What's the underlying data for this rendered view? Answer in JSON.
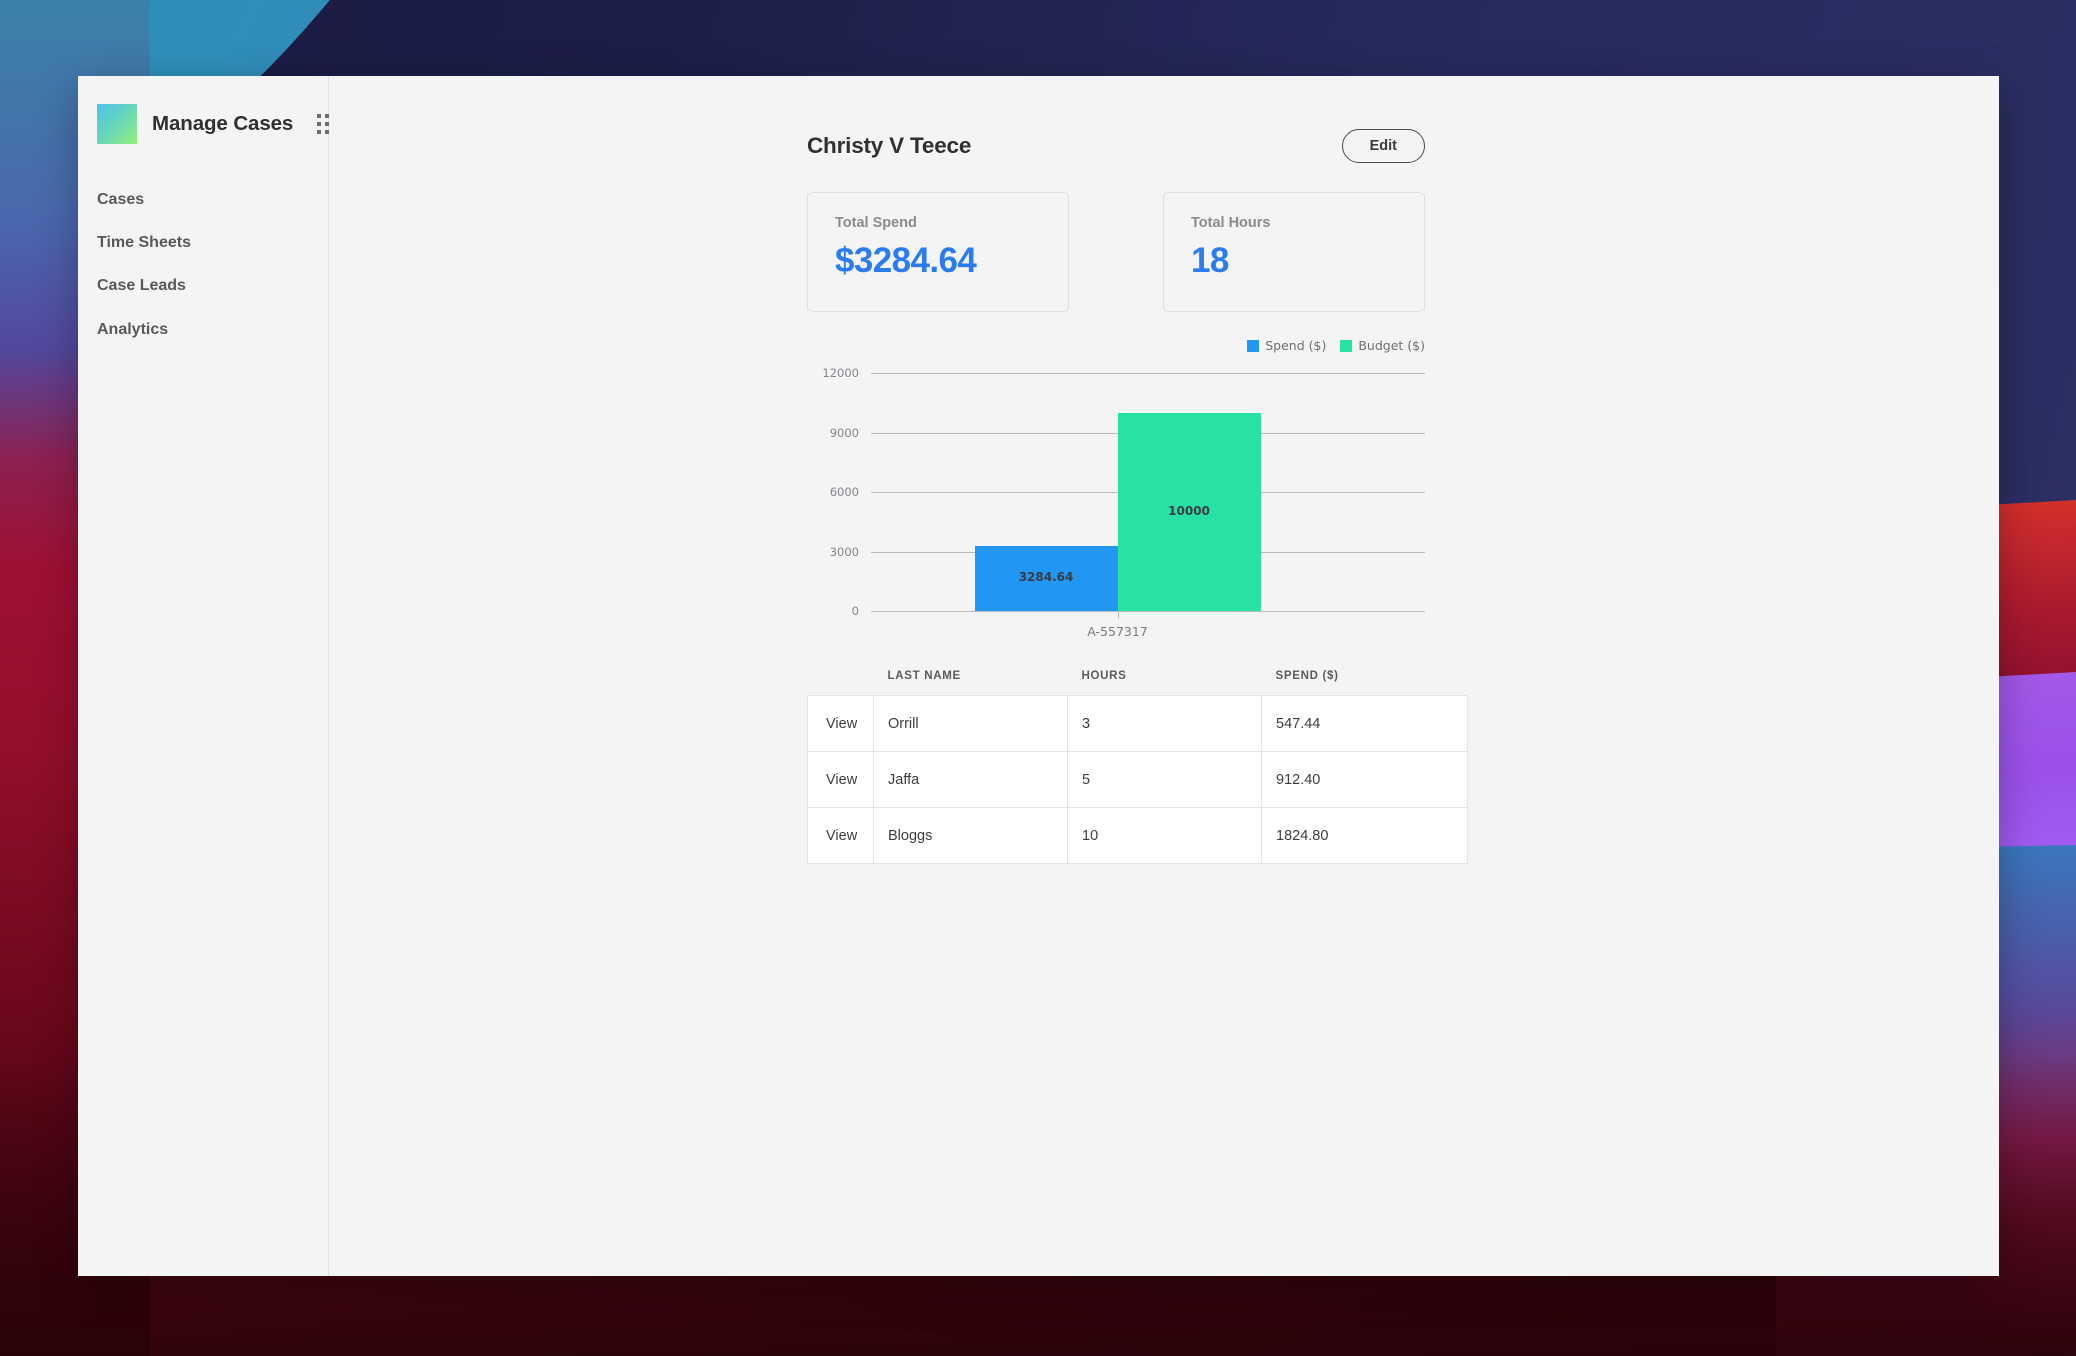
{
  "sidebar": {
    "brand_title": "Manage Cases",
    "app_grid_icon": "grid-apps-icon",
    "items": [
      {
        "label": "Cases"
      },
      {
        "label": "Time Sheets"
      },
      {
        "label": "Case Leads"
      },
      {
        "label": "Analytics"
      }
    ]
  },
  "header": {
    "title": "Christy V Teece",
    "edit_label": "Edit"
  },
  "cards": [
    {
      "label": "Total Spend",
      "value": "$3284.64"
    },
    {
      "label": "Total Hours",
      "value": "18"
    }
  ],
  "colors": {
    "accent_blue": "#2a7cf0",
    "spend_blue": "#2196f3",
    "budget_green": "#27e2a4",
    "logo_gradient_start": "#4fc3e8",
    "logo_gradient_end": "#93f07a"
  },
  "chart_data": {
    "type": "bar",
    "title": "",
    "xlabel": "",
    "ylabel": "",
    "categories": [
      "A-557317"
    ],
    "series": [
      {
        "name": "Spend ($)",
        "values": [
          3284.64
        ],
        "color": "#2196f3",
        "label": "3284.64"
      },
      {
        "name": "Budget ($)",
        "values": [
          10000
        ],
        "color": "#27e2a4",
        "label": "10000"
      }
    ],
    "ylim": [
      0,
      12000
    ],
    "yticks": [
      "0",
      "3000",
      "6000",
      "9000",
      "12000"
    ],
    "ytick_values": [
      0,
      3000,
      6000,
      9000,
      12000
    ],
    "grid": true,
    "legend_position": "top-right",
    "legend": [
      "Spend ($)",
      "Budget ($)"
    ]
  },
  "table": {
    "columns": [
      "",
      "LAST NAME",
      "HOURS",
      "SPEND ($)"
    ],
    "view_label": "View",
    "rows": [
      {
        "view": "View",
        "last_name": "Orrill",
        "hours": "3",
        "spend": "547.44"
      },
      {
        "view": "View",
        "last_name": "Jaffa",
        "hours": "5",
        "spend": "912.40"
      },
      {
        "view": "View",
        "last_name": "Bloggs",
        "hours": "10",
        "spend": "1824.80"
      }
    ]
  }
}
